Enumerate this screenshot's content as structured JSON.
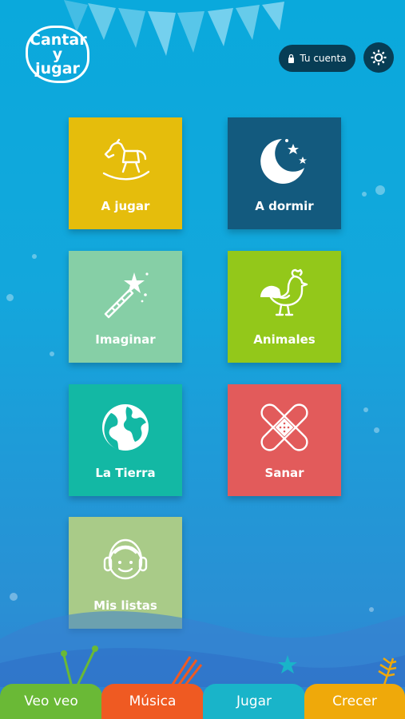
{
  "brand": {
    "logo_text": "Cantar y jugar"
  },
  "header": {
    "account_label": "Tu cuenta",
    "settings_icon": "gear-icon"
  },
  "tiles": [
    {
      "label": "A jugar",
      "icon": "rocking-horse-icon",
      "color": "#e5bd0c"
    },
    {
      "label": "A dormir",
      "icon": "moon-stars-icon",
      "color": "#135a7e"
    },
    {
      "label": "Imaginar",
      "icon": "magic-wand-icon",
      "color": "#86cfa6"
    },
    {
      "label": "Animales",
      "icon": "rooster-icon",
      "color": "#93c81a"
    },
    {
      "label": "La Tierra",
      "icon": "globe-icon",
      "color": "#13b8a4"
    },
    {
      "label": "Sanar",
      "icon": "bandage-icon",
      "color": "#e25b5b"
    },
    {
      "label": "Mis listas",
      "icon": "headphones-kid-icon",
      "color": "#a9cb88"
    }
  ],
  "tabs": [
    {
      "label": "Veo veo",
      "color": "#6ab936"
    },
    {
      "label": "Música",
      "color": "#ef5a22"
    },
    {
      "label": "Jugar",
      "color": "#19b4c9"
    },
    {
      "label": "Crecer",
      "color": "#efa90a"
    }
  ]
}
